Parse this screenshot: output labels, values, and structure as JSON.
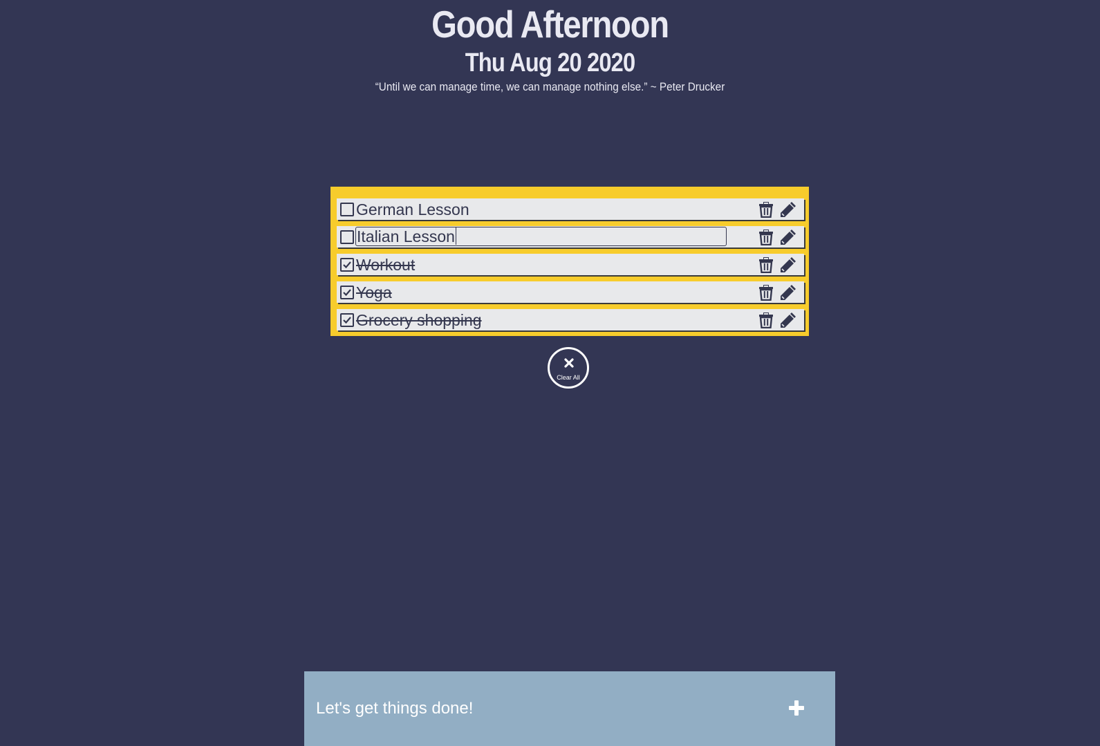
{
  "header": {
    "greeting": "Good Afternoon",
    "date": "Thu Aug 20 2020",
    "quote": "“Until we can manage time, we can manage nothing else.” ~ Peter Drucker"
  },
  "tasks": [
    {
      "text": "German Lesson",
      "done": false,
      "editing": false
    },
    {
      "text": "Italian Lesson",
      "done": false,
      "editing": true
    },
    {
      "text": "Workout",
      "done": true,
      "editing": false
    },
    {
      "text": "Yoga",
      "done": true,
      "editing": false
    },
    {
      "text": "Grocery shopping",
      "done": true,
      "editing": false
    }
  ],
  "clear_all": {
    "label": "Clear All",
    "icon": "close-icon"
  },
  "add_bar": {
    "placeholder": "Let's get things done!",
    "icon": "plus-icon"
  },
  "colors": {
    "background": "#333654",
    "list_panel": "#f7cc2c",
    "task_bg": "#e8e9eb",
    "task_text": "#34374f",
    "add_bar": "#92aec4"
  }
}
